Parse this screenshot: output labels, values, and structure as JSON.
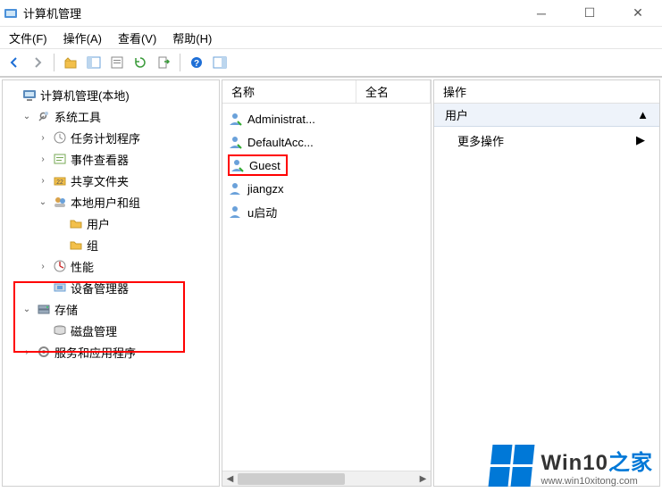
{
  "window": {
    "title": "计算机管理"
  },
  "menu": {
    "file": "文件(F)",
    "action": "操作(A)",
    "view": "查看(V)",
    "help": "帮助(H)"
  },
  "tree": {
    "root": "计算机管理(本地)",
    "system_tools": "系统工具",
    "task_scheduler": "任务计划程序",
    "event_viewer": "事件查看器",
    "shared_folders": "共享文件夹",
    "local_users_groups": "本地用户和组",
    "users": "用户",
    "groups": "组",
    "performance": "性能",
    "device_manager": "设备管理器",
    "storage": "存储",
    "disk_management": "磁盘管理",
    "services_apps": "服务和应用程序"
  },
  "list": {
    "columns": {
      "name": "名称",
      "fullname": "全名"
    },
    "items": [
      {
        "name": "Administrat..."
      },
      {
        "name": "DefaultAcc..."
      },
      {
        "name": "Guest"
      },
      {
        "name": "jiangzx"
      },
      {
        "name": "u启动"
      }
    ]
  },
  "actions": {
    "header": "操作",
    "section": "用户",
    "more": "更多操作"
  },
  "watermark": {
    "brand_a": "Win10",
    "brand_b": "之家",
    "url": "www.win10xitong.com"
  }
}
